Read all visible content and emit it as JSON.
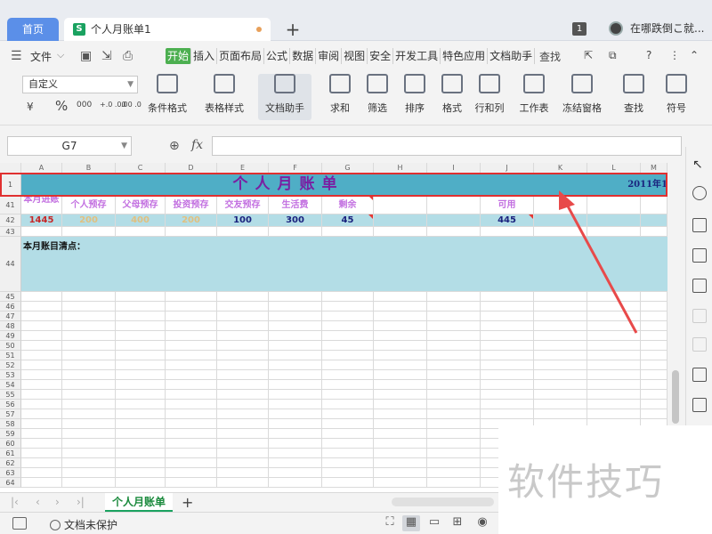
{
  "titlebar": {
    "home_tab": "首页",
    "doc_tab": "个人月账单1",
    "doc_icon": "S",
    "new_tab": "+",
    "window_count": "1",
    "user_name": "在哪跌倒こ就..."
  },
  "menubar": {
    "file": "文件",
    "tabs": [
      "开始",
      "插入",
      "页面布局",
      "公式",
      "数据",
      "审阅",
      "视图",
      "安全",
      "开发工具",
      "特色应用",
      "文档助手"
    ],
    "active_tab": "开始",
    "search": "查找"
  },
  "ribbon": {
    "number_format": "自定义",
    "percent": "%",
    "yuan": "¥",
    "thousands": "000",
    "dec_add": "+.0 .00",
    "dec_sub": ".00 .0",
    "buttons": [
      "条件格式",
      "表格样式",
      "文档助手",
      "求和",
      "筛选",
      "排序",
      "格式",
      "行和列",
      "工作表",
      "冻结窗格",
      "查找",
      "符号"
    ]
  },
  "formulabar": {
    "cell_ref": "G7",
    "fx": "fx",
    "value": ""
  },
  "sheet": {
    "columns": [
      "A",
      "B",
      "C",
      "D",
      "E",
      "F",
      "G",
      "H",
      "I",
      "J",
      "K",
      "L",
      "M"
    ],
    "title": "个人月账单",
    "year": "2011年1",
    "row_numbers": [
      "1",
      "41",
      "42",
      "43",
      "44",
      "45",
      "46",
      "47",
      "48",
      "49",
      "50",
      "51",
      "52",
      "53",
      "54",
      "55",
      "56",
      "57",
      "58",
      "59",
      "60",
      "61",
      "62",
      "63",
      "64"
    ],
    "headers": [
      "本月进账",
      "个人预存",
      "父母预存",
      "投资预存",
      "交友预存",
      "生活费",
      "剩余",
      "",
      "",
      "可用",
      "",
      "",
      ""
    ],
    "values": [
      "1445",
      "200",
      "400",
      "200",
      "100",
      "300",
      "45",
      "",
      "",
      "445",
      "",
      "",
      ""
    ],
    "note": "本月账目清点："
  },
  "sheet_tabs": {
    "active": "个人月账单",
    "add": "+"
  },
  "statusbar": {
    "protect": "文档未保护"
  },
  "watermark": "软件技巧"
}
